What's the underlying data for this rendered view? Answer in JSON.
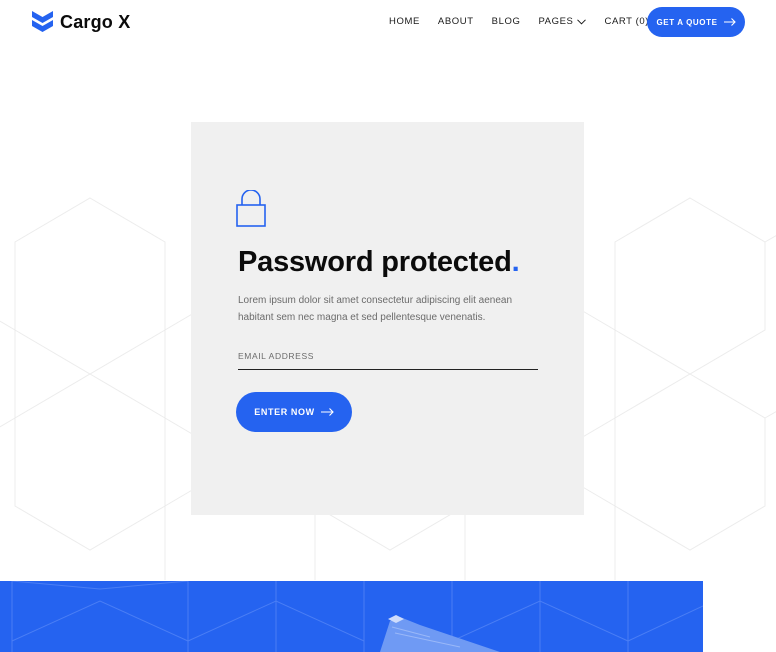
{
  "brand": {
    "name": "Cargo X",
    "accent": "#2563f0"
  },
  "nav": {
    "items": [
      {
        "label": "HOME"
      },
      {
        "label": "ABOUT"
      },
      {
        "label": "BLOG"
      },
      {
        "label": "PAGES",
        "icon": "chevron-down-icon"
      },
      {
        "label": "CART (0)"
      }
    ],
    "cta_label": "GET A QUOTE"
  },
  "card": {
    "icon": "lock-icon",
    "title": "Password protected",
    "title_dot": ".",
    "description": "Lorem ipsum dolor sit amet consectetur adipiscing elit aenean habitant sem nec magna et sed pellentesque venenatis.",
    "email_placeholder": "EMAIL ADDRESS",
    "submit_label": "ENTER NOW"
  },
  "colors": {
    "accent": "#2563f0",
    "card_bg": "#f0f0f0",
    "text": "#0b0b0b",
    "muted": "#6b6b6b"
  }
}
